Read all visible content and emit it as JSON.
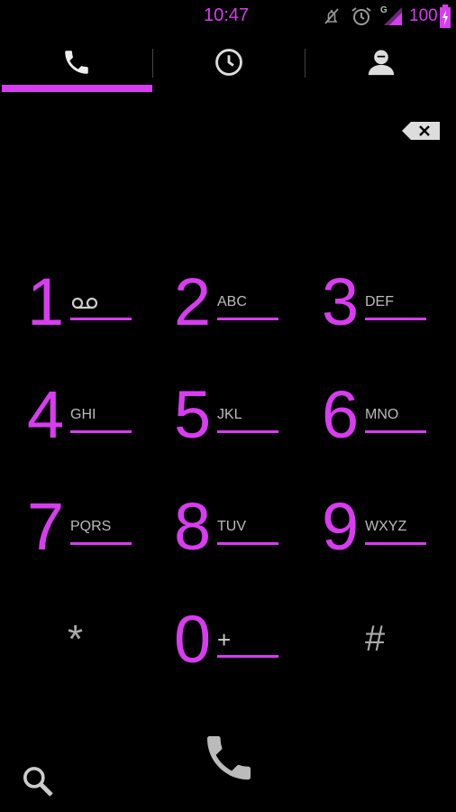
{
  "status_bar": {
    "time": "10:47",
    "battery": "100",
    "network_type": "G",
    "accent_color": "#d83cf0",
    "icons": [
      "mute-icon",
      "alarm-icon",
      "signal-icon",
      "battery-icon"
    ]
  },
  "tabs": [
    {
      "icon": "phone-icon",
      "selected": true
    },
    {
      "icon": "clock-icon",
      "selected": false
    },
    {
      "icon": "contact-icon",
      "selected": false
    }
  ],
  "keypad": {
    "keys": [
      {
        "digit": "1",
        "letters": "",
        "sub_icon": "voicemail-icon"
      },
      {
        "digit": "2",
        "letters": "ABC"
      },
      {
        "digit": "3",
        "letters": "DEF"
      },
      {
        "digit": "4",
        "letters": "GHI"
      },
      {
        "digit": "5",
        "letters": "JKL"
      },
      {
        "digit": "6",
        "letters": "MNO"
      },
      {
        "digit": "7",
        "letters": "PQRS"
      },
      {
        "digit": "8",
        "letters": "TUV"
      },
      {
        "digit": "9",
        "letters": "WXYZ"
      },
      {
        "digit": "*",
        "letters": ""
      },
      {
        "digit": "0",
        "letters": "+"
      },
      {
        "digit": "#",
        "letters": ""
      }
    ]
  },
  "actions": {
    "call_icon": "phone-icon",
    "search_icon": "search-icon",
    "backspace_icon": "backspace-icon"
  }
}
